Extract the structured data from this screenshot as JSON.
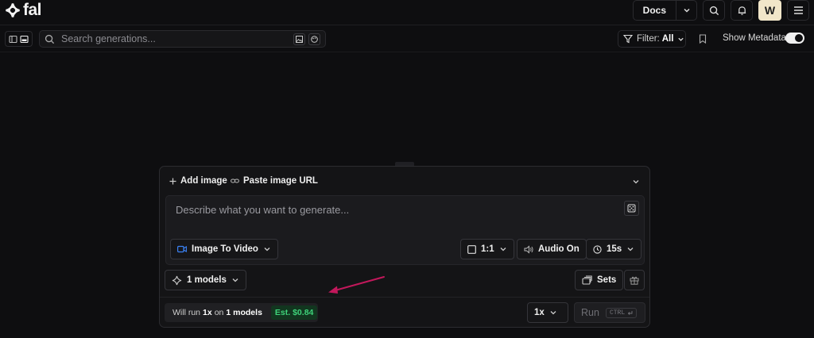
{
  "brand": {
    "name": "fal"
  },
  "topbar": {
    "docs_label": "Docs",
    "avatar_initial": "W"
  },
  "toolbar": {
    "search_placeholder": "Search generations...",
    "filter_label": "Filter:",
    "filter_value": "All",
    "show_metadata_label": "Show Metadata",
    "show_metadata_on": true
  },
  "composer": {
    "add_image_label": "Add image",
    "paste_url_label": "Paste image URL",
    "prompt_placeholder": "Describe what you want to generate...",
    "mode_label": "Image To Video",
    "aspect_label": "1:1",
    "audio_label": "Audio On",
    "duration_label": "15s",
    "models_label": "1 models",
    "sets_label": "Sets",
    "run_info": {
      "prefix": "Will run",
      "count": "1x",
      "middle": "on",
      "models": "1 models",
      "estimate": "Est. $0.84"
    },
    "multiplier_label": "1x",
    "run_label": "Run",
    "shortcut_label": "CTRL"
  },
  "colors": {
    "background": "#0e0e10",
    "panel": "#141416",
    "accent_blue": "#3b82f6",
    "estimate_green": "#3fd27a",
    "annotation_arrow": "#c2185b"
  }
}
